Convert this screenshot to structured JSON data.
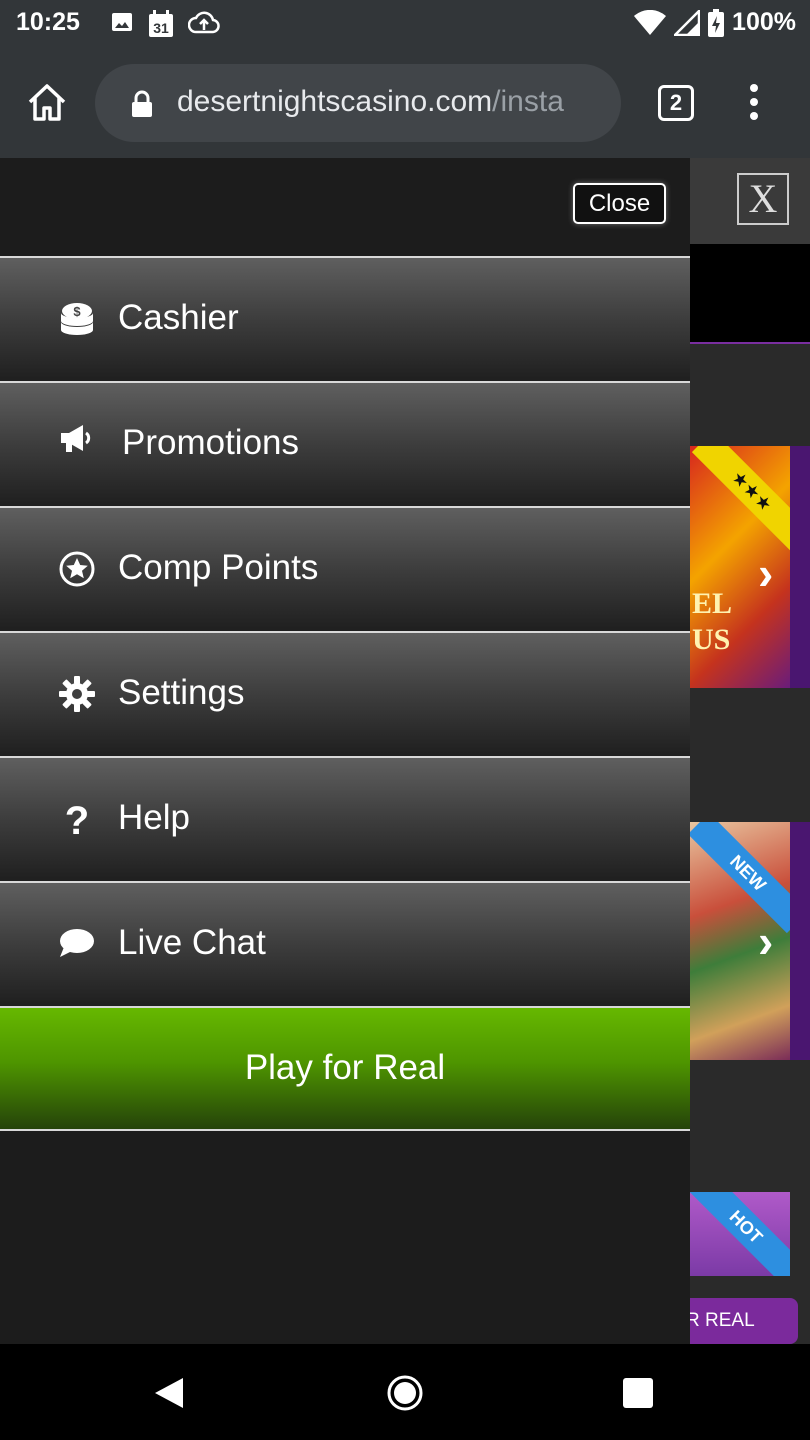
{
  "status_bar": {
    "time": "10:25",
    "calendar_day": "31",
    "battery": "100%",
    "icons_left": [
      "image-icon",
      "calendar-icon",
      "cloud-upload-icon"
    ],
    "icons_right": [
      "wifi-icon",
      "cell-signal-icon",
      "battery-charging-icon"
    ]
  },
  "browser": {
    "url_main": "desertnightscasino.com",
    "url_rest": "/insta",
    "tab_count": "2"
  },
  "menu": {
    "close_label": "Close",
    "items": [
      {
        "label": "Cashier",
        "icon": "coins-icon"
      },
      {
        "label": "Promotions",
        "icon": "megaphone-icon"
      },
      {
        "label": "Comp Points",
        "icon": "star-circle-icon"
      },
      {
        "label": "Settings",
        "icon": "gear-icon"
      },
      {
        "label": "Help",
        "icon": "question-icon"
      },
      {
        "label": "Live Chat",
        "icon": "chat-bubble-icon"
      }
    ],
    "play_real_label": "Play for Real",
    "play_real_color": "#5aa800"
  },
  "background_page": {
    "close_x": "X",
    "tiles": [
      {
        "ribbon": "★★★",
        "text": "EL\nUS"
      },
      {
        "ribbon": "NEW"
      },
      {
        "ribbon": "HOT"
      }
    ],
    "play_button_partial": "R REAL",
    "accent_color": "#7b2a9c"
  }
}
